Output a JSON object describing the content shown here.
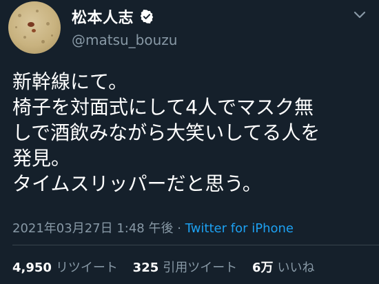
{
  "user": {
    "display_name": "松本人志",
    "handle": "@matsu_bouzu",
    "verified": true,
    "avatar_icon": "avatar-image",
    "verified_icon": "verified-badge-icon",
    "menu_icon": "chevron-down-icon"
  },
  "tweet": {
    "lines": [
      "新幹線にて。",
      "椅子を対面式にして4人でマスク無",
      "しで酒飲みながら大笑いしてる人を",
      "発見。",
      "タイムスリッパーだと思う。"
    ]
  },
  "meta": {
    "timestamp": "2021年03月27日 1:48 午後",
    "separator": "·",
    "source": "Twitter for iPhone"
  },
  "stats": {
    "retweets": {
      "count": "4,950",
      "label": "リツイート"
    },
    "quotes": {
      "count": "325",
      "label": "引用ツイート"
    },
    "likes": {
      "count": "6万",
      "label": "いいね"
    }
  },
  "colors": {
    "background": "#15202b",
    "muted_text": "#8899a6",
    "accent": "#1da1f2"
  }
}
